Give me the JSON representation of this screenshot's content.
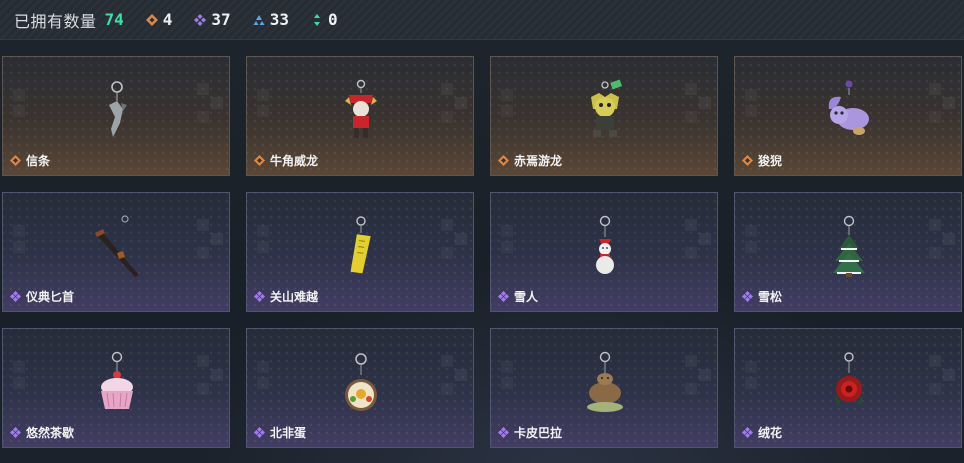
{
  "header": {
    "owned_label": "已拥有数量",
    "owned_count": "74",
    "stats": [
      {
        "icon": "orange-diamond-icon",
        "color": "#d9884a",
        "value": "4"
      },
      {
        "icon": "purple-diamond-icon",
        "color": "#a07ce8",
        "value": "37"
      },
      {
        "icon": "blue-triangle-icon",
        "color": "#5aa8e8",
        "value": "33"
      },
      {
        "icon": "green-arrows-icon",
        "color": "#3fe0a6",
        "value": "0"
      }
    ]
  },
  "items": [
    {
      "name": "信条",
      "rarity": "gold",
      "icon": "diamond-icon",
      "art": "blade-keychain-icon"
    },
    {
      "name": "牛角威龙",
      "rarity": "gold",
      "icon": "diamond-icon",
      "art": "red-warrior-keychain-icon"
    },
    {
      "name": "赤焉游龙",
      "rarity": "gold",
      "icon": "diamond-icon",
      "art": "yellow-creature-keychain-icon"
    },
    {
      "name": "狻猊",
      "rarity": "gold",
      "icon": "diamond-icon",
      "art": "purple-lion-keychain-icon"
    },
    {
      "name": "仪典匕首",
      "rarity": "purple",
      "icon": "diamond-icon",
      "art": "dagger-keychain-icon"
    },
    {
      "name": "关山难越",
      "rarity": "purple",
      "icon": "diamond-icon",
      "art": "yellow-tag-keychain-icon"
    },
    {
      "name": "雪人",
      "rarity": "purple",
      "icon": "diamond-icon",
      "art": "snowman-keychain-icon"
    },
    {
      "name": "雪松",
      "rarity": "purple",
      "icon": "diamond-icon",
      "art": "pine-tree-keychain-icon"
    },
    {
      "name": "悠然茶歇",
      "rarity": "purple",
      "icon": "diamond-icon",
      "art": "cupcake-keychain-icon"
    },
    {
      "name": "北非蛋",
      "rarity": "purple",
      "icon": "diamond-icon",
      "art": "egg-pan-keychain-icon"
    },
    {
      "name": "卡皮巴拉",
      "rarity": "purple",
      "icon": "diamond-icon",
      "art": "capybara-keychain-icon"
    },
    {
      "name": "绒花",
      "rarity": "purple",
      "icon": "diamond-icon",
      "art": "red-flower-keychain-icon"
    }
  ],
  "colors": {
    "gold_accent": "#d9884a",
    "purple_accent": "#a07ce8",
    "count_green": "#3fe0a6"
  }
}
